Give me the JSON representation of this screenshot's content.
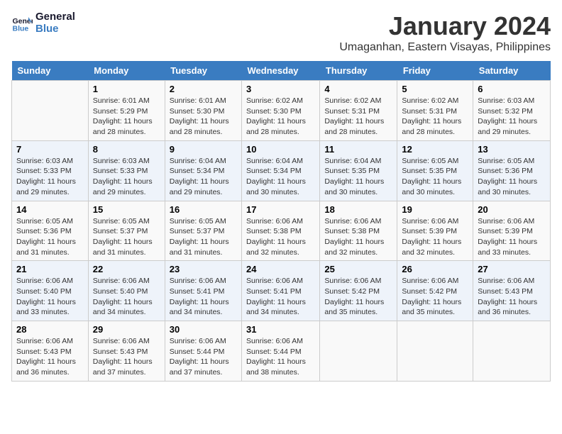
{
  "header": {
    "logo_line1": "General",
    "logo_line2": "Blue",
    "month": "January 2024",
    "location": "Umaganhan, Eastern Visayas, Philippines"
  },
  "weekdays": [
    "Sunday",
    "Monday",
    "Tuesday",
    "Wednesday",
    "Thursday",
    "Friday",
    "Saturday"
  ],
  "weeks": [
    [
      {
        "day": "",
        "sunrise": "",
        "sunset": "",
        "daylight": ""
      },
      {
        "day": "1",
        "sunrise": "6:01 AM",
        "sunset": "5:29 PM",
        "daylight": "11 hours and 28 minutes."
      },
      {
        "day": "2",
        "sunrise": "6:01 AM",
        "sunset": "5:30 PM",
        "daylight": "11 hours and 28 minutes."
      },
      {
        "day": "3",
        "sunrise": "6:02 AM",
        "sunset": "5:30 PM",
        "daylight": "11 hours and 28 minutes."
      },
      {
        "day": "4",
        "sunrise": "6:02 AM",
        "sunset": "5:31 PM",
        "daylight": "11 hours and 28 minutes."
      },
      {
        "day": "5",
        "sunrise": "6:02 AM",
        "sunset": "5:31 PM",
        "daylight": "11 hours and 28 minutes."
      },
      {
        "day": "6",
        "sunrise": "6:03 AM",
        "sunset": "5:32 PM",
        "daylight": "11 hours and 29 minutes."
      }
    ],
    [
      {
        "day": "7",
        "sunrise": "6:03 AM",
        "sunset": "5:33 PM",
        "daylight": "11 hours and 29 minutes."
      },
      {
        "day": "8",
        "sunrise": "6:03 AM",
        "sunset": "5:33 PM",
        "daylight": "11 hours and 29 minutes."
      },
      {
        "day": "9",
        "sunrise": "6:04 AM",
        "sunset": "5:34 PM",
        "daylight": "11 hours and 29 minutes."
      },
      {
        "day": "10",
        "sunrise": "6:04 AM",
        "sunset": "5:34 PM",
        "daylight": "11 hours and 30 minutes."
      },
      {
        "day": "11",
        "sunrise": "6:04 AM",
        "sunset": "5:35 PM",
        "daylight": "11 hours and 30 minutes."
      },
      {
        "day": "12",
        "sunrise": "6:05 AM",
        "sunset": "5:35 PM",
        "daylight": "11 hours and 30 minutes."
      },
      {
        "day": "13",
        "sunrise": "6:05 AM",
        "sunset": "5:36 PM",
        "daylight": "11 hours and 30 minutes."
      }
    ],
    [
      {
        "day": "14",
        "sunrise": "6:05 AM",
        "sunset": "5:36 PM",
        "daylight": "11 hours and 31 minutes."
      },
      {
        "day": "15",
        "sunrise": "6:05 AM",
        "sunset": "5:37 PM",
        "daylight": "11 hours and 31 minutes."
      },
      {
        "day": "16",
        "sunrise": "6:05 AM",
        "sunset": "5:37 PM",
        "daylight": "11 hours and 31 minutes."
      },
      {
        "day": "17",
        "sunrise": "6:06 AM",
        "sunset": "5:38 PM",
        "daylight": "11 hours and 32 minutes."
      },
      {
        "day": "18",
        "sunrise": "6:06 AM",
        "sunset": "5:38 PM",
        "daylight": "11 hours and 32 minutes."
      },
      {
        "day": "19",
        "sunrise": "6:06 AM",
        "sunset": "5:39 PM",
        "daylight": "11 hours and 32 minutes."
      },
      {
        "day": "20",
        "sunrise": "6:06 AM",
        "sunset": "5:39 PM",
        "daylight": "11 hours and 33 minutes."
      }
    ],
    [
      {
        "day": "21",
        "sunrise": "6:06 AM",
        "sunset": "5:40 PM",
        "daylight": "11 hours and 33 minutes."
      },
      {
        "day": "22",
        "sunrise": "6:06 AM",
        "sunset": "5:40 PM",
        "daylight": "11 hours and 34 minutes."
      },
      {
        "day": "23",
        "sunrise": "6:06 AM",
        "sunset": "5:41 PM",
        "daylight": "11 hours and 34 minutes."
      },
      {
        "day": "24",
        "sunrise": "6:06 AM",
        "sunset": "5:41 PM",
        "daylight": "11 hours and 34 minutes."
      },
      {
        "day": "25",
        "sunrise": "6:06 AM",
        "sunset": "5:42 PM",
        "daylight": "11 hours and 35 minutes."
      },
      {
        "day": "26",
        "sunrise": "6:06 AM",
        "sunset": "5:42 PM",
        "daylight": "11 hours and 35 minutes."
      },
      {
        "day": "27",
        "sunrise": "6:06 AM",
        "sunset": "5:43 PM",
        "daylight": "11 hours and 36 minutes."
      }
    ],
    [
      {
        "day": "28",
        "sunrise": "6:06 AM",
        "sunset": "5:43 PM",
        "daylight": "11 hours and 36 minutes."
      },
      {
        "day": "29",
        "sunrise": "6:06 AM",
        "sunset": "5:43 PM",
        "daylight": "11 hours and 37 minutes."
      },
      {
        "day": "30",
        "sunrise": "6:06 AM",
        "sunset": "5:44 PM",
        "daylight": "11 hours and 37 minutes."
      },
      {
        "day": "31",
        "sunrise": "6:06 AM",
        "sunset": "5:44 PM",
        "daylight": "11 hours and 38 minutes."
      },
      {
        "day": "",
        "sunrise": "",
        "sunset": "",
        "daylight": ""
      },
      {
        "day": "",
        "sunrise": "",
        "sunset": "",
        "daylight": ""
      },
      {
        "day": "",
        "sunrise": "",
        "sunset": "",
        "daylight": ""
      }
    ]
  ],
  "labels": {
    "sunrise_prefix": "Sunrise: ",
    "sunset_prefix": "Sunset: ",
    "daylight_prefix": "Daylight: "
  }
}
